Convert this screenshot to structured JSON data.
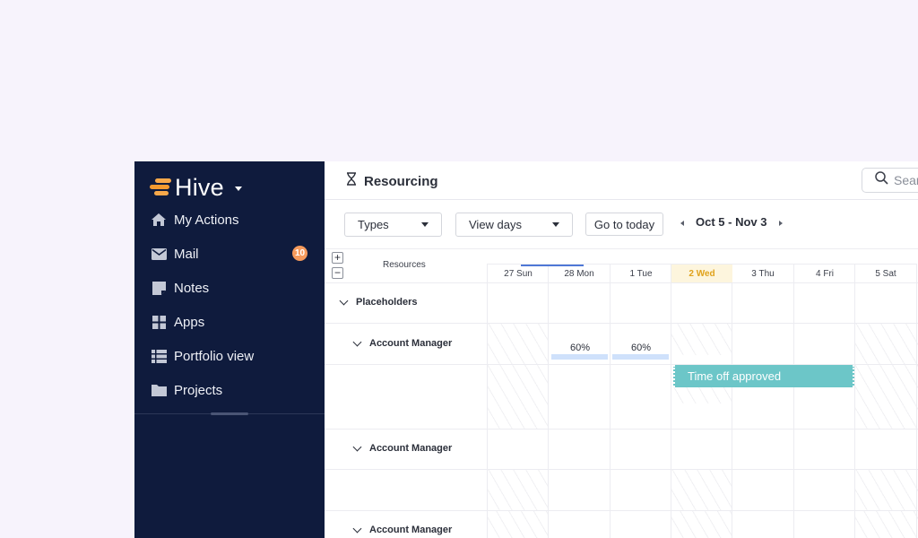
{
  "app": {
    "name": "Hive"
  },
  "sidebar": {
    "items": [
      {
        "label": "My Actions",
        "icon": "home-icon"
      },
      {
        "label": "Mail",
        "icon": "mail-icon",
        "badge": "10"
      },
      {
        "label": "Notes",
        "icon": "note-icon"
      },
      {
        "label": "Apps",
        "icon": "apps-icon"
      },
      {
        "label": "Portfolio view",
        "icon": "list-icon"
      },
      {
        "label": "Projects",
        "icon": "folder-icon"
      }
    ]
  },
  "header": {
    "title": "Resourcing",
    "search_placeholder": "Search"
  },
  "toolbar": {
    "types_label": "Types",
    "view_label": "View days",
    "today_label": "Go to today",
    "date_range": "Oct 5 - Nov 3"
  },
  "grid": {
    "resources_header": "Resources",
    "plus": "+",
    "minus": "−",
    "days": [
      "27 Sun",
      "28 Mon",
      "1 Tue",
      "2 Wed",
      "3 Thu",
      "4 Fri",
      "5 Sat"
    ],
    "today_index": 3,
    "rows": {
      "placeholders": "Placeholders",
      "account_manager_1": "Account Manager",
      "account_manager_2": "Account Manager",
      "account_manager_3": "Account Manager"
    },
    "allocations": [
      {
        "day": "28 Mon",
        "label": "60%"
      },
      {
        "day": "1 Tue",
        "label": "60%"
      }
    ],
    "time_off": {
      "label": "Time off approved"
    }
  },
  "colors": {
    "sidebar_bg": "#0f1b3d",
    "accent_orange": "#f59a2f",
    "time_off": "#6cc6c8",
    "today_highlight": "#fdf5dd",
    "allocation_bar": "#cfe1fb"
  }
}
